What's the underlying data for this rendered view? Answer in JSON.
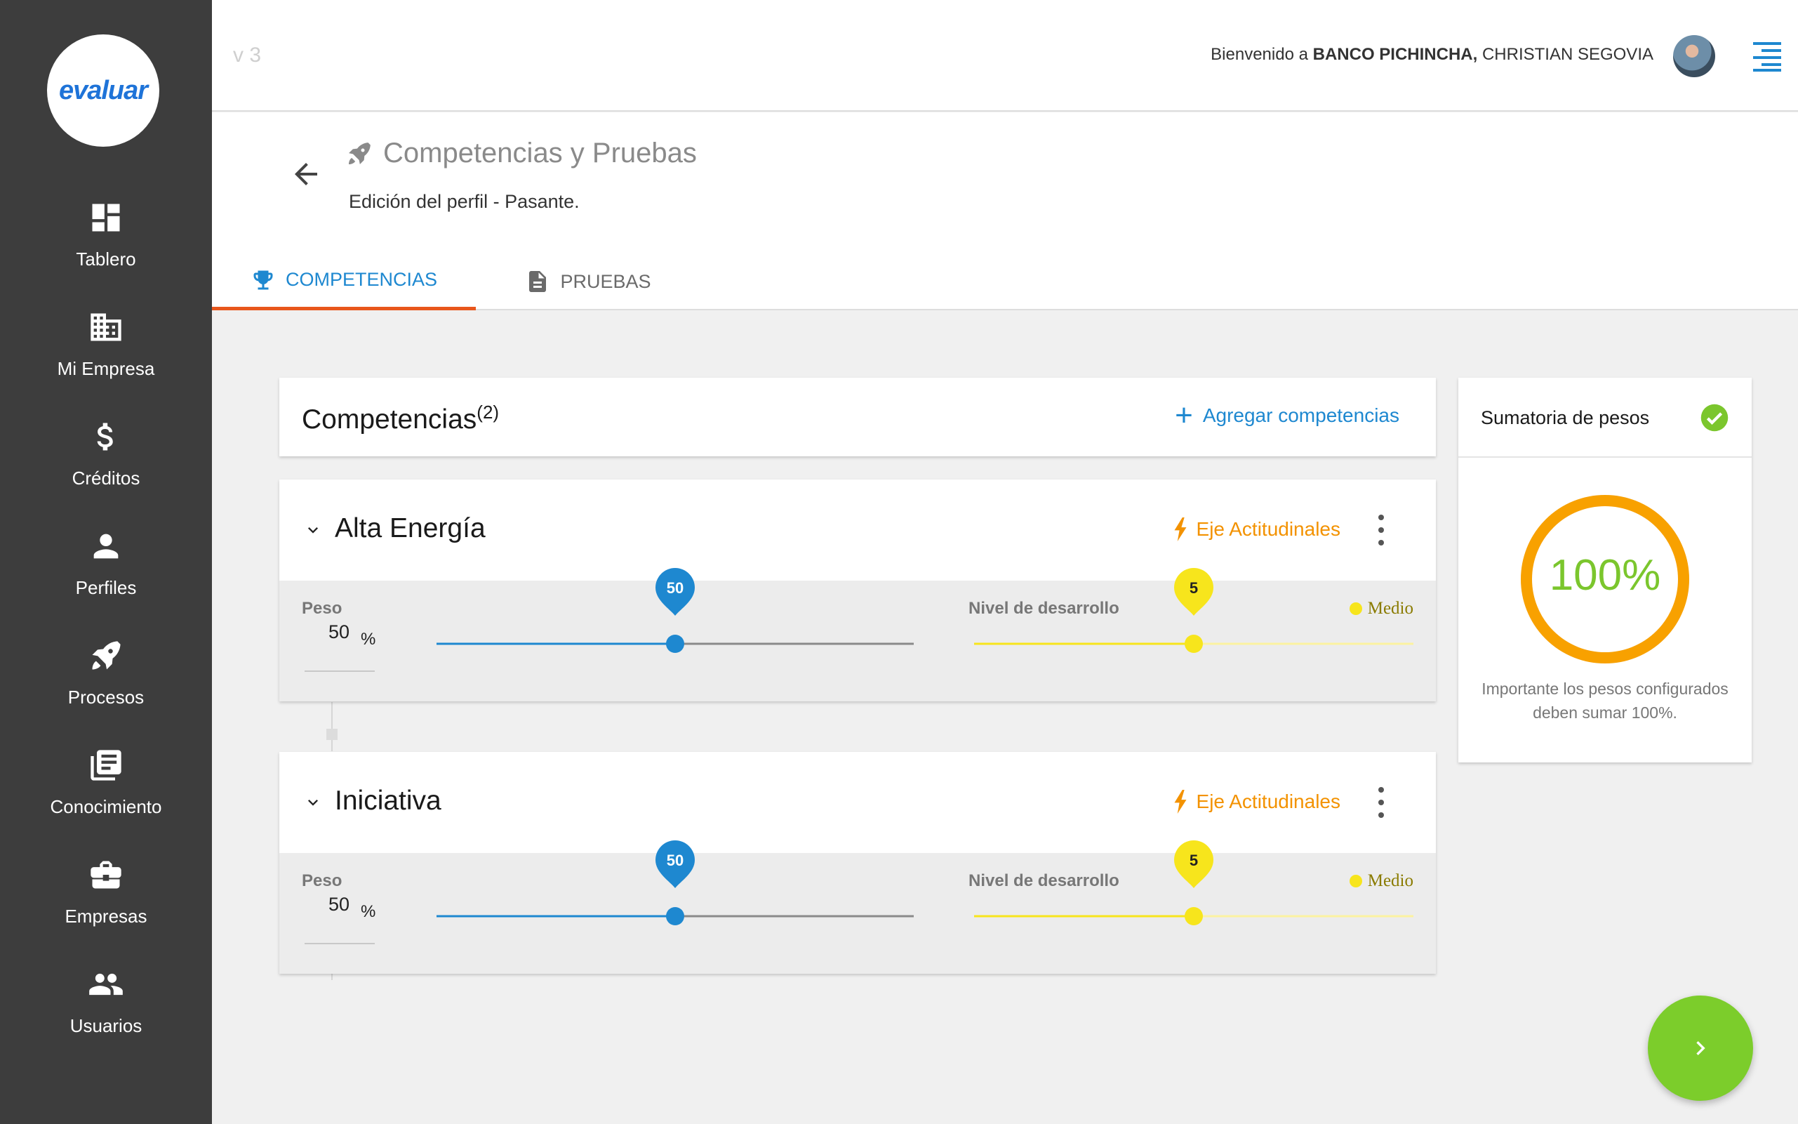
{
  "app": {
    "version": "v 3",
    "logo_text": "evaluar"
  },
  "header": {
    "welcome_prefix": "Bienvenido a ",
    "company": "BANCO PICHINCHA,",
    "user": " CHRISTIAN SEGOVIA"
  },
  "sidebar": {
    "items": [
      {
        "label": "Tablero",
        "icon": "dashboard-icon"
      },
      {
        "label": "Mi Empresa",
        "icon": "building-icon"
      },
      {
        "label": "Créditos",
        "icon": "dollar-icon"
      },
      {
        "label": "Perfiles",
        "icon": "person-icon"
      },
      {
        "label": "Procesos",
        "icon": "rocket-icon"
      },
      {
        "label": "Conocimiento",
        "icon": "library-icon"
      },
      {
        "label": "Empresas",
        "icon": "briefcase-icon"
      },
      {
        "label": "Usuarios",
        "icon": "group-icon"
      }
    ]
  },
  "page": {
    "title": "Competencias y Pruebas",
    "subtitle": "Edición del perfil - Pasante.",
    "tabs": [
      {
        "label": "COMPETENCIAS",
        "active": true,
        "icon": "trophy-icon"
      },
      {
        "label": "PRUEBAS",
        "active": false,
        "icon": "document-icon"
      }
    ]
  },
  "competencias": {
    "title": "Competencias",
    "count": "(2)",
    "add_label": "Agregar competencias",
    "items": [
      {
        "name": "Alta Energía",
        "eje": "Eje Actitudinales",
        "peso_label": "Peso",
        "peso_value": "50",
        "peso_unit": "%",
        "peso_slider": 50,
        "nivel_label": "Nivel de desarrollo",
        "nivel_value": 5,
        "nivel_max": 10,
        "nivel_text": "Medio"
      },
      {
        "name": "Iniciativa",
        "eje": "Eje Actitudinales",
        "peso_label": "Peso",
        "peso_value": "50",
        "peso_unit": "%",
        "peso_slider": 50,
        "nivel_label": "Nivel de desarrollo",
        "nivel_value": 5,
        "nivel_max": 10,
        "nivel_text": "Medio"
      }
    ]
  },
  "sumatoria": {
    "title": "Sumatoria de pesos",
    "value": "100%",
    "progress": 1.0,
    "note": "Importante los pesos configurados deben sumar 100%."
  },
  "colors": {
    "accent_blue": "#1e88d0",
    "tab_underline": "#e8561c",
    "eje_orange": "#f39200",
    "nivel_yellow": "#f7e51c",
    "success_green": "#7bc62d",
    "ring_orange": "#f8a100",
    "sidebar_bg": "#3d3d3d"
  }
}
